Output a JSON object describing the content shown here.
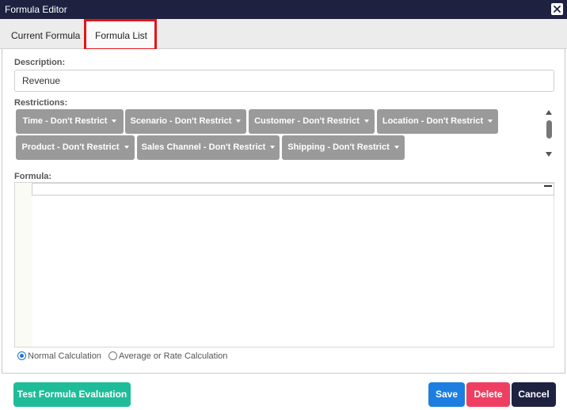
{
  "window": {
    "title": "Formula Editor"
  },
  "tabs": [
    {
      "label": "Current Formula"
    },
    {
      "label": "Formula List"
    }
  ],
  "form": {
    "description_label": "Description:",
    "description_value": "Revenue",
    "restrictions_label": "Restrictions:",
    "restrictions": [
      {
        "label": "Time - Don't Restrict"
      },
      {
        "label": "Scenario - Don't Restrict"
      },
      {
        "label": "Customer - Don't Restrict"
      },
      {
        "label": "Location - Don't Restrict"
      },
      {
        "label": "Product - Don't Restrict"
      },
      {
        "label": "Sales Channel - Don't Restrict"
      },
      {
        "label": "Shipping - Don't Restrict"
      }
    ],
    "formula_label": "Formula:",
    "formula_value": "",
    "calc_options": [
      {
        "label": "Normal Calculation",
        "checked": true
      },
      {
        "label": "Average or Rate Calculation",
        "checked": false
      }
    ]
  },
  "footer": {
    "test_label": "Test Formula Evaluation",
    "save_label": "Save",
    "delete_label": "Delete",
    "cancel_label": "Cancel"
  },
  "colors": {
    "titlebar": "#1e2140",
    "highlight_box": "#e4141b",
    "restriction_button": "#9a9a9a",
    "test_button": "#1fbc99",
    "save_button": "#1c7ee0",
    "delete_button": "#ee3f62",
    "cancel_button": "#1e2140"
  }
}
